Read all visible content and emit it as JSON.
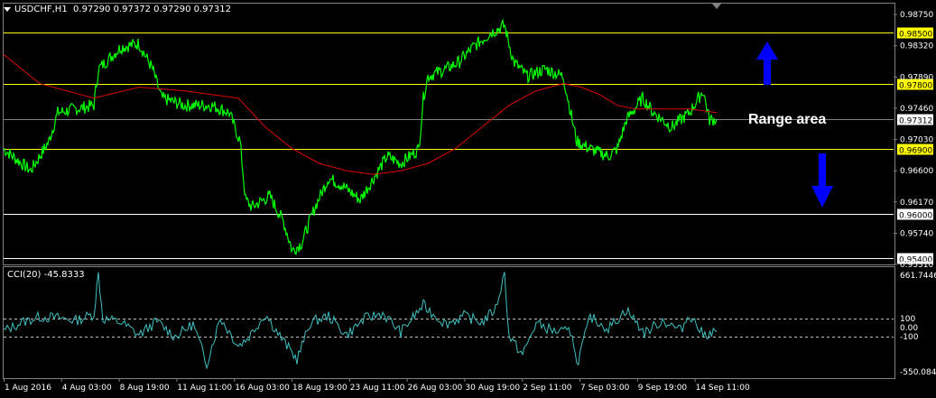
{
  "header": {
    "symbol": "USDCHF,H1",
    "ohlc": "0.97290 0.97372 0.97290 0.97312"
  },
  "annotation": {
    "text": "Range area"
  },
  "chart_data": [
    {
      "type": "line",
      "panel": "price",
      "ylim": [
        0.9531,
        0.989
      ],
      "y_ticks": [
        "0.98750",
        "0.98320",
        "0.97890",
        "0.97460",
        "0.97030",
        "0.96600",
        "0.96170",
        "0.95740",
        "0.95310"
      ],
      "y_tick_values": [
        0.9875,
        0.9832,
        0.9789,
        0.9746,
        0.9703,
        0.966,
        0.9617,
        0.9574,
        0.9531
      ],
      "levels": [
        {
          "value": 0.985,
          "label": "0.98500",
          "color": "#ffff00"
        },
        {
          "value": 0.978,
          "label": "0.97800",
          "color": "#ffff00"
        },
        {
          "value": 0.969,
          "label": "0.96900",
          "color": "#ffff00"
        },
        {
          "value": 0.96,
          "label": "0.96000",
          "color": "#ffffff"
        },
        {
          "value": 0.954,
          "label": "0.95400",
          "color": "#ffffff"
        }
      ],
      "current_price": {
        "value": 0.97312,
        "label": "0.97312"
      },
      "x_labels": [
        "1 Aug 2016",
        "4 Aug 03:00",
        "8 Aug 19:00",
        "11 Aug 11:00",
        "16 Aug 03:00",
        "18 Aug 19:00",
        "23 Aug 11:00",
        "26 Aug 03:00",
        "30 Aug 19:00",
        "2 Sep 11:00",
        "7 Sep 03:00",
        "9 Sep 19:00",
        "14 Sep 11:00"
      ],
      "series": [
        {
          "color": "#00ff00",
          "x": [
            0,
            30,
            50,
            60,
            80,
            100,
            105,
            130,
            150,
            165,
            175,
            200,
            230,
            250,
            262,
            268,
            275,
            295,
            310,
            320,
            330,
            345,
            360,
            375,
            395,
            410,
            425,
            440,
            460,
            465,
            470,
            490,
            505,
            520,
            540,
            555,
            565,
            580,
            600,
            620,
            635,
            650,
            670,
            680,
            690,
            708,
            720,
            740,
            760,
            775,
            782,
            790
          ],
          "values": [
            0.969,
            0.966,
            0.97,
            0.974,
            0.9745,
            0.975,
            0.98,
            0.983,
            0.9835,
            0.98,
            0.976,
            0.975,
            0.975,
            0.974,
            0.97,
            0.962,
            0.961,
            0.9625,
            0.959,
            0.955,
            0.956,
            0.961,
            0.965,
            0.964,
            0.962,
            0.965,
            0.968,
            0.967,
            0.969,
            0.976,
            0.979,
            0.98,
            0.981,
            0.983,
            0.985,
            0.986,
            0.981,
            0.979,
            0.98,
            0.979,
            0.97,
            0.969,
            0.968,
            0.969,
            0.973,
            0.976,
            0.974,
            0.972,
            0.974,
            0.977,
            0.973,
            0.9731
          ]
        },
        {
          "color": "#e00000",
          "x": [
            0,
            40,
            100,
            150,
            200,
            260,
            290,
            320,
            350,
            380,
            410,
            440,
            470,
            500,
            530,
            560,
            590,
            620,
            640,
            660,
            680,
            700,
            730,
            760,
            790
          ],
          "values": [
            0.982,
            0.978,
            0.976,
            0.9775,
            0.977,
            0.976,
            0.972,
            0.969,
            0.967,
            0.966,
            0.9655,
            0.966,
            0.967,
            0.969,
            0.972,
            0.975,
            0.977,
            0.978,
            0.9775,
            0.9765,
            0.975,
            0.9745,
            0.9745,
            0.9745,
            0.974
          ]
        }
      ]
    },
    {
      "type": "line",
      "panel": "indicator",
      "title": "CCI(20) -45.8333",
      "ylim": [
        -550.0847,
        661.7446
      ],
      "y_ticks": [
        "661.7446",
        "100",
        "0.00",
        "-100",
        "-550.0847"
      ],
      "y_tick_values": [
        661.7446,
        100,
        0,
        -100,
        -550.0847
      ],
      "levels": [
        100,
        -100
      ],
      "series": [
        {
          "color": "#40c0c0",
          "x": [
            0,
            20,
            40,
            60,
            80,
            100,
            105,
            110,
            130,
            150,
            170,
            190,
            210,
            225,
            240,
            260,
            270,
            290,
            310,
            325,
            340,
            360,
            380,
            400,
            420,
            440,
            465,
            470,
            490,
            510,
            530,
            545,
            555,
            560,
            575,
            590,
            610,
            630,
            635,
            650,
            670,
            690,
            710,
            730,
            750,
            760,
            775,
            790
          ],
          "values": [
            -40,
            60,
            120,
            110,
            80,
            150,
            600,
            100,
            60,
            -80,
            70,
            -100,
            40,
            -400,
            110,
            -200,
            -120,
            150,
            -150,
            -350,
            60,
            130,
            -80,
            100,
            160,
            -50,
            250,
            200,
            40,
            130,
            60,
            210,
            600,
            -100,
            -300,
            50,
            -40,
            -50,
            -420,
            120,
            -10,
            200,
            -60,
            80,
            -30,
            150,
            -80,
            -45.8333
          ]
        }
      ]
    }
  ]
}
